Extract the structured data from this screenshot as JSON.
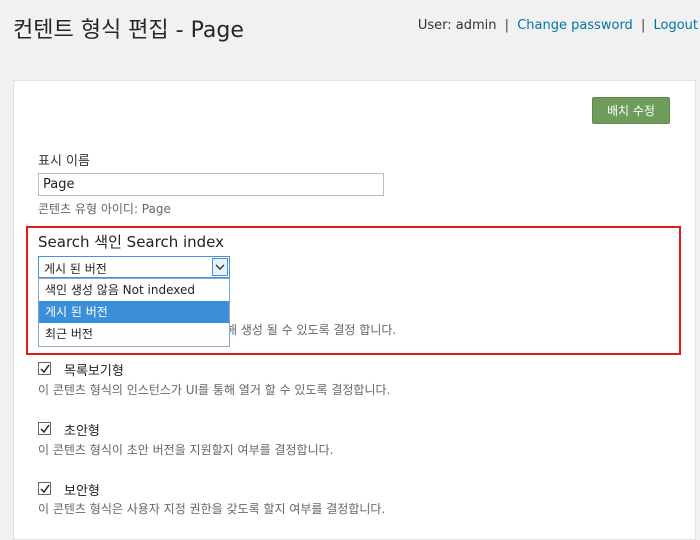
{
  "header": {
    "title": "컨텐트 형식 편집 - Page",
    "user_label": "User: admin",
    "change_password": "Change password",
    "separator": "|",
    "logout": "Logout"
  },
  "form": {
    "apply_button": "배치 수정",
    "display_name_label": "표시 이름",
    "display_name_value": "Page",
    "content_type_id": "콘텐츠 유형 아이디: Page",
    "search_index": {
      "title": "Search 색인 Search index",
      "selected_value": "게시 된 버전",
      "options": [
        "색인 생성 않음 Not indexed",
        "게시 된 버전",
        "최근 버전"
      ],
      "description_partial": "해 생성 될 수 있도록 결정 합니다."
    },
    "checkboxes": [
      {
        "label": "목록보기형",
        "checked": true,
        "description": "이 콘텐츠 형식의 인스턴스가 UI를 통해 열거 할 수 있도록 결정합니다."
      },
      {
        "label": "초안형",
        "checked": true,
        "description": "이 콘텐츠 형식이 초안 버전을 지원할지 여부를 결정합니다."
      },
      {
        "label": "보안형",
        "checked": true,
        "description": "이 콘텐츠 형식은 사용자 지정 권한을 갖도록 할지 여부를 결정합니다."
      }
    ]
  },
  "colors": {
    "accent_button": "#6f9c5a",
    "link": "#0073aa",
    "highlight_border": "#e01b1b",
    "selected_option": "#3b8fd9"
  }
}
